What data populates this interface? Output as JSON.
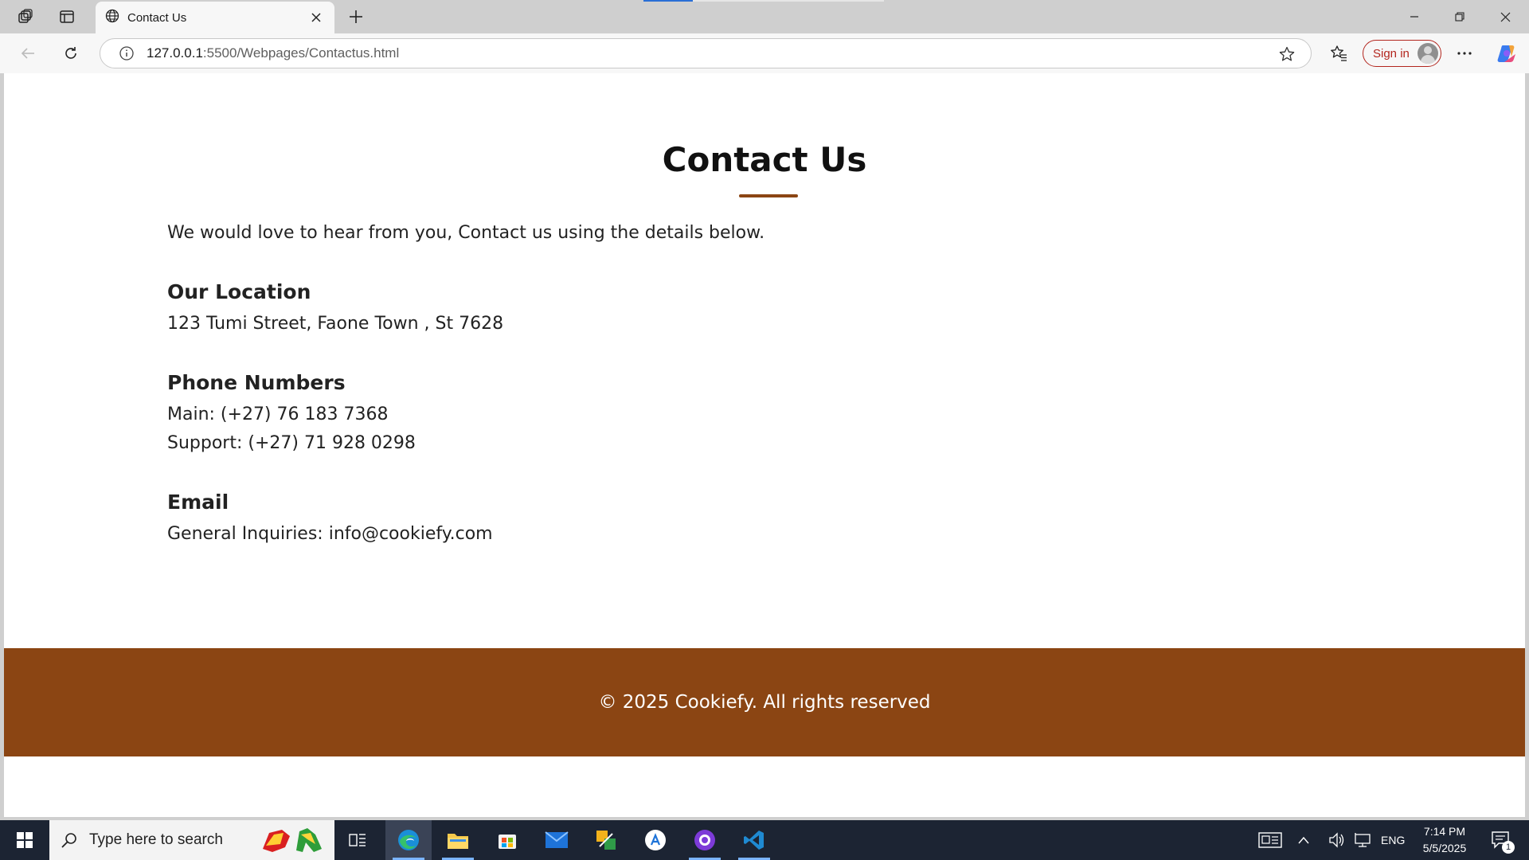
{
  "browser": {
    "tab_title": "Contact Us",
    "url_host": "127.0.0.1",
    "url_path": ":5500/Webpages/Contactus.html",
    "signin_label": "Sign in"
  },
  "page": {
    "title": "Contact Us",
    "intro": "We would love to hear from you, Contact us using the details below.",
    "location": {
      "heading": "Our Location",
      "address": "123 Tumi Street, Faone Town , St 7628"
    },
    "phones": {
      "heading": "Phone Numbers",
      "main": "Main: (+27) 76 183 7368",
      "support": "Support: (+27) 71 928 0298"
    },
    "email": {
      "heading": "Email",
      "general": "General Inquiries: info@cookiefy.com"
    },
    "footer": "© 2025 Cookiefy. All rights reserved"
  },
  "taskbar": {
    "search_placeholder": "Type here to search",
    "language": "ENG",
    "time": "7:14 PM",
    "date": "5/5/2025",
    "notification_count": "1"
  },
  "colors": {
    "accent_brown": "#8b4513",
    "signin_red": "#b3261e"
  }
}
